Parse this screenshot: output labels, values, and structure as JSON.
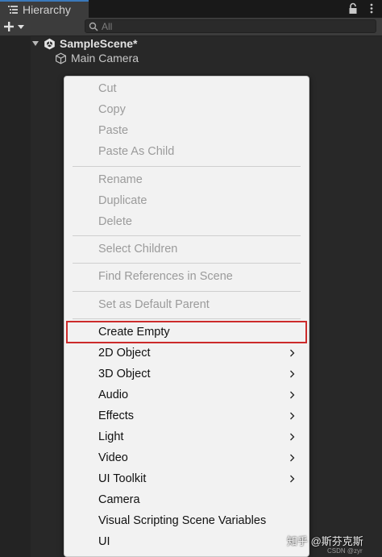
{
  "window": {
    "tab_title": "Hierarchy"
  },
  "toolbar": {
    "search_placeholder": "All"
  },
  "tree": {
    "scene_name": "SampleScene*",
    "objects": [
      "Main Camera"
    ]
  },
  "context_menu": {
    "highlight_color": "#cc2b2b",
    "groups": [
      [
        {
          "label": "Cut",
          "enabled": false
        },
        {
          "label": "Copy",
          "enabled": false
        },
        {
          "label": "Paste",
          "enabled": false
        },
        {
          "label": "Paste As Child",
          "enabled": false
        }
      ],
      [
        {
          "label": "Rename",
          "enabled": false
        },
        {
          "label": "Duplicate",
          "enabled": false
        },
        {
          "label": "Delete",
          "enabled": false
        }
      ],
      [
        {
          "label": "Select Children",
          "enabled": false
        }
      ],
      [
        {
          "label": "Find References in Scene",
          "enabled": false
        }
      ],
      [
        {
          "label": "Set as Default Parent",
          "enabled": false
        }
      ],
      [
        {
          "label": "Create Empty",
          "enabled": true,
          "highlighted": true
        },
        {
          "label": "2D Object",
          "enabled": true,
          "submenu": true
        },
        {
          "label": "3D Object",
          "enabled": true,
          "submenu": true
        },
        {
          "label": "Audio",
          "enabled": true,
          "submenu": true
        },
        {
          "label": "Effects",
          "enabled": true,
          "submenu": true
        },
        {
          "label": "Light",
          "enabled": true,
          "submenu": true
        },
        {
          "label": "Video",
          "enabled": true,
          "submenu": true
        },
        {
          "label": "UI Toolkit",
          "enabled": true,
          "submenu": true
        },
        {
          "label": "Camera",
          "enabled": true
        },
        {
          "label": "Visual Scripting Scene Variables",
          "enabled": true
        },
        {
          "label": "UI",
          "enabled": true
        }
      ]
    ]
  },
  "watermark": {
    "text": "知乎 @斯芬克斯",
    "sub": "CSDN @zyr"
  }
}
